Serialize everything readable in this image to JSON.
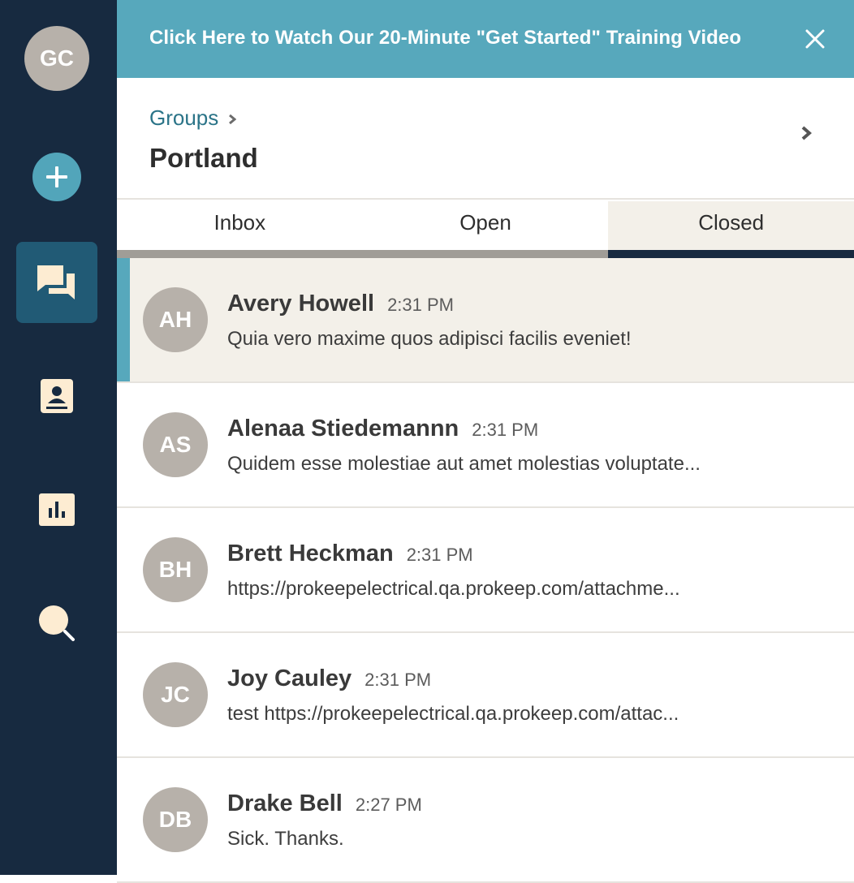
{
  "colors": {
    "sidebar_bg": "#172a40",
    "banner_bg": "#57a8bc",
    "accent": "#52a5ba",
    "link": "#2b7488",
    "avatar_bg": "#b7b1aa",
    "selected_bg": "#f3f0e9",
    "icon_cream": "#fdecd2"
  },
  "sidebar": {
    "user_initials": "GC",
    "items": [
      {
        "icon": "add-icon"
      },
      {
        "icon": "conversations-icon",
        "active": true
      },
      {
        "icon": "contacts-icon"
      },
      {
        "icon": "reports-icon"
      },
      {
        "icon": "search-icon"
      }
    ]
  },
  "banner": {
    "text": "Click Here to Watch Our 20-Minute \"Get Started\" Training Video",
    "close_icon": "close-icon"
  },
  "header": {
    "breadcrumb": "Groups",
    "title": "Portland"
  },
  "tabs": [
    {
      "label": "Inbox",
      "active": false
    },
    {
      "label": "Open",
      "active": false
    },
    {
      "label": "Closed",
      "active": true
    }
  ],
  "conversations": [
    {
      "initials": "AH",
      "name": "Avery Howell",
      "time": "2:31 PM",
      "message": "Quia vero maxime quos adipisci facilis eveniet!",
      "selected": true
    },
    {
      "initials": "AS",
      "name": "Alenaa Stiedemannn",
      "time": "2:31 PM",
      "message": "Quidem esse molestiae aut amet molestias voluptate..."
    },
    {
      "initials": "BH",
      "name": "Brett Heckman",
      "time": "2:31 PM",
      "message": "https://prokeepelectrical.qa.prokeep.com/attachme..."
    },
    {
      "initials": "JC",
      "name": "Joy Cauley",
      "time": "2:31 PM",
      "message": "test https://prokeepelectrical.qa.prokeep.com/attac..."
    },
    {
      "initials": "DB",
      "name": "Drake Bell",
      "time": "2:27 PM",
      "message": "Sick. Thanks."
    }
  ]
}
